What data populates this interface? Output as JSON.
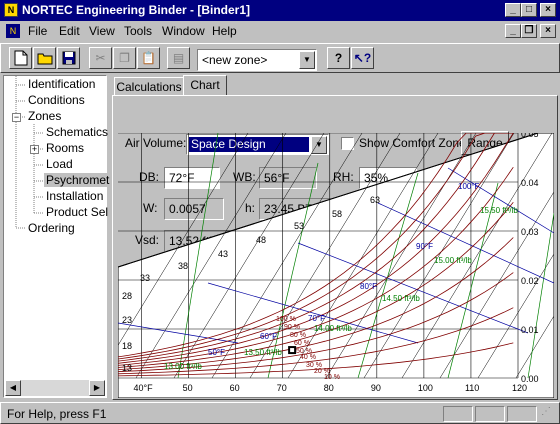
{
  "window": {
    "title": "NORTEC Engineering Binder - [Binder1]",
    "app_icon": "binder-icon",
    "caption_buttons": {
      "minimize": "_",
      "maximize": "□",
      "close": "×"
    }
  },
  "menu": {
    "items": [
      "File",
      "Edit",
      "View",
      "Tools",
      "Window",
      "Help"
    ],
    "mdi_buttons": {
      "minimize": "_",
      "restore": "❐",
      "close": "×"
    }
  },
  "toolbar": {
    "zone_combo_value": "<new zone>",
    "buttons": [
      "new-file-icon",
      "open-folder-icon",
      "save-icon",
      "cut-icon",
      "copy-icon",
      "paste-icon",
      "print-icon",
      "help-icon",
      "context-help-icon"
    ]
  },
  "tree": {
    "items": [
      {
        "label": "Identification",
        "level": 0
      },
      {
        "label": "Conditions",
        "level": 0
      },
      {
        "label": "Zones",
        "level": 0,
        "expander": "−"
      },
      {
        "label": "Schematics",
        "level": 1
      },
      {
        "label": "Rooms",
        "level": 1,
        "expander": "+"
      },
      {
        "label": "Load",
        "level": 1
      },
      {
        "label": "Psychromet",
        "level": 1,
        "selected": true
      },
      {
        "label": "Installation",
        "level": 1
      },
      {
        "label": "Product Sel",
        "level": 1
      },
      {
        "label": "Ordering",
        "level": 0
      }
    ]
  },
  "tabs": [
    {
      "label": "Calculations",
      "active": false
    },
    {
      "label": "Chart",
      "active": true
    }
  ],
  "form": {
    "air_volume_label": "Air Volume:",
    "air_volume_value": "Space Design",
    "comfort_label": "Show Comfort Zone",
    "comfort_checked": false,
    "range_button": "Range",
    "db_label": "DB:",
    "db_value": "72°F",
    "wb_label": "WB:",
    "wb_value": "56°F",
    "rh_label": "RH:",
    "rh_value": "35%",
    "w_label": "W:",
    "w_value": "0.0057",
    "h_label": "h:",
    "h_value": "23.45 BTU",
    "vsd_label": "Vsd:",
    "vsd_value": "13.52 ft³/lb"
  },
  "chart_data": {
    "type": "psychrometric",
    "x_ticks": [
      "40°F",
      "50",
      "60",
      "70",
      "80",
      "90",
      "100",
      "110",
      "120"
    ],
    "y_ticks": [
      "0.05",
      "0.04",
      "0.03",
      "0.02",
      "0.01",
      "0.00"
    ],
    "enthalpy_labels": [
      "13",
      "18",
      "23",
      "28",
      "33",
      "38",
      "43",
      "48",
      "53",
      "58",
      "63"
    ],
    "wetbulb_labels": [
      "100°F",
      "90°F",
      "80°F",
      "70°F",
      "60°F",
      "50°F"
    ],
    "volume_labels": [
      "15.50 ft³/lb",
      "15.00 ft³/lb",
      "14.50 ft³/lb",
      "14.00 ft³/lb",
      "13.50 ft³/lb",
      "13.00 ft³/lb"
    ],
    "rh_labels": [
      "100 %",
      "90 %",
      "80 %",
      "60 %",
      "50 %",
      "40 %",
      "30 %",
      "20 %",
      "10 %"
    ],
    "state_point": {
      "db": 72,
      "w": 0.0057
    },
    "colors": {
      "enthalpy": "#000000",
      "rh": "#800000",
      "volume": "#008000",
      "wetbulb": "#0000a0",
      "grid": "#000000"
    }
  },
  "status": {
    "text": "For Help, press F1"
  }
}
